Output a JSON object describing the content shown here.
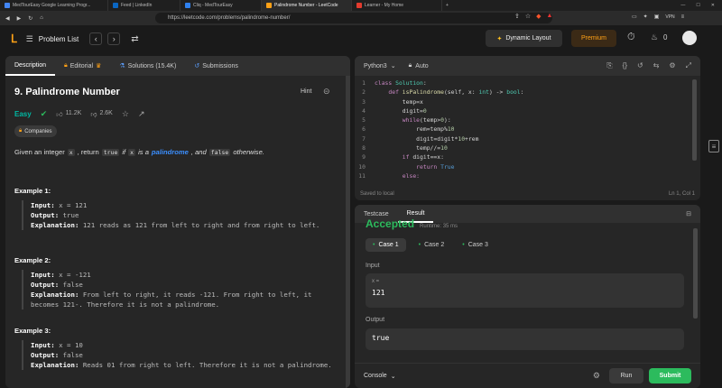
{
  "browser": {
    "tabs": [
      {
        "label": "MedTourEasy Google Learning Progr...",
        "color": "#4285f4"
      },
      {
        "label": "Feed | LinkedIn",
        "color": "#0a66c2"
      },
      {
        "label": "Cliq - MedTourEasy",
        "color": "#2f80ed"
      },
      {
        "label": "Palindrome Number - LeetCode",
        "color": "#ffa116"
      },
      {
        "label": "Learner - My Home",
        "color": "#e33b2e"
      }
    ],
    "url": "https://leetcode.com/problems/palindrome-number/",
    "vpn": "VPN"
  },
  "nav": {
    "problem_list": "Problem List",
    "dynamic_layout": "Dynamic Layout",
    "premium": "Premium",
    "streak": "0"
  },
  "left": {
    "tabs": [
      "Description",
      "Editorial",
      "Solutions (15.4K)",
      "Submissions"
    ],
    "title": "9. Palindrome Number",
    "hint": "Hint",
    "difficulty": "Easy",
    "likes": "11.2K",
    "dislikes": "2.6K",
    "companies": "Companies",
    "desc": {
      "p1": "Given an integer",
      "x": "x",
      "p2": ", return",
      "true": "true",
      "if": "if",
      "x2": "x",
      "isa": "is a",
      "palindrome": "palindrome",
      "and": ", and",
      "false": "false",
      "otherwise": "otherwise."
    },
    "examples": [
      {
        "title": "Example 1:",
        "input": "x = 121",
        "output": "true",
        "explanation": "121 reads as 121 from left to right and from right to left."
      },
      {
        "title": "Example 2:",
        "input": "x = -121",
        "output": "false",
        "explanation": "From left to right, it reads -121. From right to left, it becomes 121-. Therefore it is not a palindrome."
      },
      {
        "title": "Example 3:",
        "input": "x = 10",
        "output": "false",
        "explanation": "Reads 01 from right to left. Therefore it is not a palindrome."
      }
    ],
    "labels": {
      "input": "Input:",
      "output": "Output:",
      "explanation": "Explanation:"
    }
  },
  "editor": {
    "language": "Python3",
    "mode": "Auto",
    "saved": "Saved to local",
    "cursor": "Ln 1, Col 1",
    "lines": [
      [
        [
          "class ",
          "kw"
        ],
        [
          "Solution",
          "cl"
        ],
        [
          ":",
          "tx"
        ]
      ],
      [
        [
          "    def ",
          "kw"
        ],
        [
          "isPalindrome",
          "fn"
        ],
        [
          "(self, x: ",
          "tx"
        ],
        [
          "int",
          "cl"
        ],
        [
          ") -> ",
          "tx"
        ],
        [
          "bool",
          "cl"
        ],
        [
          ":",
          "tx"
        ]
      ],
      [
        [
          "        temp=x",
          "tx"
        ]
      ],
      [
        [
          "        digit=",
          "tx"
        ],
        [
          "0",
          "nm"
        ]
      ],
      [
        [
          "        while",
          "kw"
        ],
        [
          "(temp>",
          "tx"
        ],
        [
          "0",
          "nm"
        ],
        [
          "):",
          "tx"
        ]
      ],
      [
        [
          "            rem=temp%",
          "tx"
        ],
        [
          "10",
          "nm"
        ]
      ],
      [
        [
          "            digit=digit*",
          "tx"
        ],
        [
          "10",
          "nm"
        ],
        [
          "+rem",
          "tx"
        ]
      ],
      [
        [
          "            temp//=",
          "tx"
        ],
        [
          "10",
          "nm"
        ]
      ],
      [
        [
          "        if ",
          "kw"
        ],
        [
          "digit==x:",
          "tx"
        ]
      ],
      [
        [
          "            return ",
          "kw"
        ],
        [
          "True",
          "bi"
        ]
      ],
      [
        [
          "        else:",
          "kw"
        ]
      ]
    ]
  },
  "result": {
    "tabs": [
      "Testcase",
      "Result"
    ],
    "status": "Accepted",
    "runtime": "Runtime: 35 ms",
    "cases": [
      "Case 1",
      "Case 2",
      "Case 3"
    ],
    "input_label": "Input",
    "var_label": "x =",
    "var_value": "121",
    "output_label": "Output",
    "output_value": "true",
    "console": "Console",
    "run": "Run",
    "submit": "Submit"
  }
}
